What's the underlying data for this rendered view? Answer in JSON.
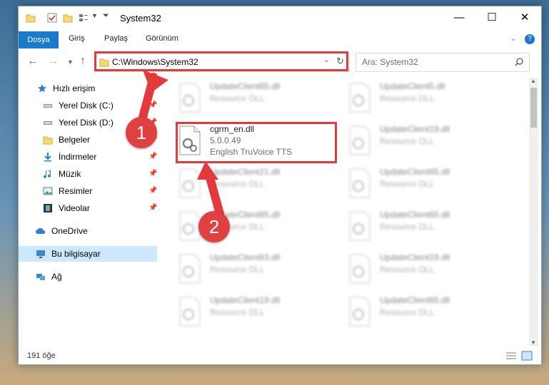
{
  "window": {
    "title": "System32"
  },
  "ribbon": {
    "tabs": [
      "Dosya",
      "Giriş",
      "Paylaş",
      "Görünüm"
    ]
  },
  "address": {
    "path": "C:\\Windows\\System32"
  },
  "search": {
    "placeholder": "Ara: System32"
  },
  "sidebar": {
    "items": [
      {
        "label": "Hızlı erişim",
        "icon": "star-icon"
      },
      {
        "label": "Yerel Disk (C:)",
        "icon": "drive-icon"
      },
      {
        "label": "Yerel Disk (D:)",
        "icon": "drive-icon"
      },
      {
        "label": "Belgeler",
        "icon": "documents-icon"
      },
      {
        "label": "İndirmeler",
        "icon": "download-icon"
      },
      {
        "label": "Müzik",
        "icon": "music-icon"
      },
      {
        "label": "Resimler",
        "icon": "pictures-icon"
      },
      {
        "label": "Videolar",
        "icon": "videos-icon"
      },
      {
        "label": "OneDrive",
        "icon": "cloud-icon"
      },
      {
        "label": "Bu bilgisayar",
        "icon": "computer-icon"
      },
      {
        "label": "Ağ",
        "icon": "network-icon"
      }
    ]
  },
  "files": {
    "highlighted": {
      "name": "cgrm_en.dll",
      "version": "5.0.0.49",
      "description": "English TruVoice TTS"
    },
    "left": [
      {
        "name": "UpdateClient65.dll",
        "desc": "Resource DLL"
      },
      {
        "name": "UpdateClient21.dll",
        "desc": "Resource DLL"
      },
      {
        "name": "UpdateClient65.dll",
        "desc": "Resource DLL"
      },
      {
        "name": "UpdateClient63.dll",
        "desc": "Resource DLL"
      },
      {
        "name": "UpdateClient19.dll",
        "desc": "Resource DLL"
      }
    ],
    "right": [
      {
        "name": "UpdateClient5.dll",
        "desc": "Resource DLL"
      },
      {
        "name": "UpdateClient19.dll",
        "desc": "Resource DLL"
      },
      {
        "name": "UpdateClient65.dll",
        "desc": "Resource DLL"
      },
      {
        "name": "UpdateClient65.dll",
        "desc": "Resource DLL"
      },
      {
        "name": "UpdateClient19.dll",
        "desc": "Resource DLL"
      },
      {
        "name": "UpdateClient65.dll",
        "desc": "Resource DLL"
      }
    ]
  },
  "status": {
    "count": "191 öğe"
  },
  "annotations": {
    "step1": "1",
    "step2": "2",
    "color": "#e33b3b"
  }
}
